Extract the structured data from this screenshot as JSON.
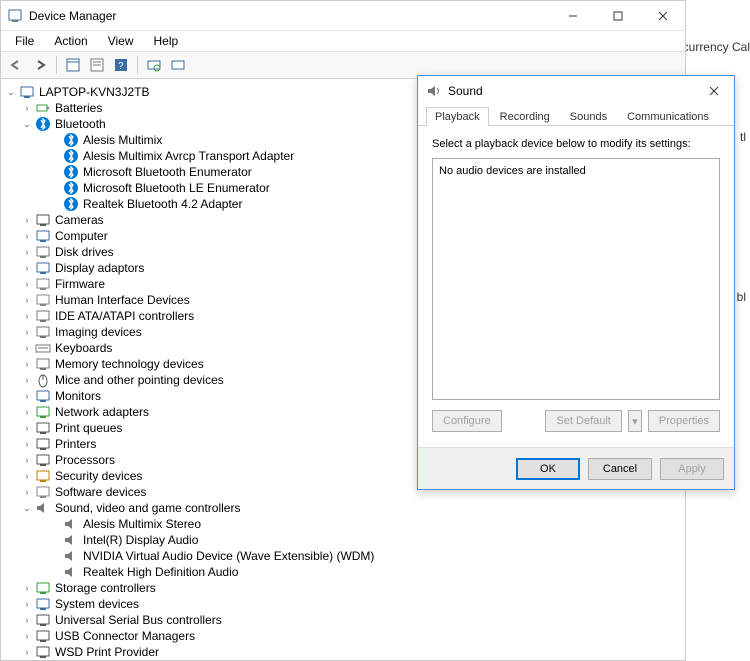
{
  "dm": {
    "title": "Device Manager",
    "menus": [
      "File",
      "Action",
      "View",
      "Help"
    ],
    "root": "LAPTOP-KVN3J2TB",
    "cats": [
      {
        "label": "Batteries",
        "exp": false,
        "icon": "battery"
      },
      {
        "label": "Bluetooth",
        "exp": true,
        "icon": "bt",
        "children": [
          "Alesis Multimix",
          "Alesis Multimix Avrcp Transport Adapter",
          "Microsoft Bluetooth Enumerator",
          "Microsoft Bluetooth LE Enumerator",
          "Realtek Bluetooth 4.2 Adapter"
        ]
      },
      {
        "label": "Cameras",
        "exp": false,
        "icon": "cam"
      },
      {
        "label": "Computer",
        "exp": false,
        "icon": "pc"
      },
      {
        "label": "Disk drives",
        "exp": false,
        "icon": "disk"
      },
      {
        "label": "Display adaptors",
        "exp": false,
        "icon": "disp"
      },
      {
        "label": "Firmware",
        "exp": false,
        "icon": "fw"
      },
      {
        "label": "Human Interface Devices",
        "exp": false,
        "icon": "hid"
      },
      {
        "label": "IDE ATA/ATAPI controllers",
        "exp": false,
        "icon": "ide"
      },
      {
        "label": "Imaging devices",
        "exp": false,
        "icon": "img"
      },
      {
        "label": "Keyboards",
        "exp": false,
        "icon": "kb"
      },
      {
        "label": "Memory technology devices",
        "exp": false,
        "icon": "mem"
      },
      {
        "label": "Mice and other pointing devices",
        "exp": false,
        "icon": "mouse"
      },
      {
        "label": "Monitors",
        "exp": false,
        "icon": "mon"
      },
      {
        "label": "Network adapters",
        "exp": false,
        "icon": "net"
      },
      {
        "label": "Print queues",
        "exp": false,
        "icon": "print"
      },
      {
        "label": "Printers",
        "exp": false,
        "icon": "print"
      },
      {
        "label": "Processors",
        "exp": false,
        "icon": "cpu"
      },
      {
        "label": "Security devices",
        "exp": false,
        "icon": "sec"
      },
      {
        "label": "Software devices",
        "exp": false,
        "icon": "sw"
      },
      {
        "label": "Sound, video and game controllers",
        "exp": true,
        "icon": "snd",
        "children": [
          "Alesis Multimix Stereo",
          "Intel(R) Display Audio",
          "NVIDIA Virtual Audio Device (Wave Extensible) (WDM)",
          "Realtek High Definition Audio"
        ]
      },
      {
        "label": "Storage controllers",
        "exp": false,
        "icon": "stor"
      },
      {
        "label": "System devices",
        "exp": false,
        "icon": "sys"
      },
      {
        "label": "Universal Serial Bus controllers",
        "exp": false,
        "icon": "usb"
      },
      {
        "label": "USB Connector Managers",
        "exp": false,
        "icon": "usb"
      },
      {
        "label": "WSD Print Provider",
        "exp": false,
        "icon": "print"
      }
    ]
  },
  "sound": {
    "title": "Sound",
    "tabs": [
      "Playback",
      "Recording",
      "Sounds",
      "Communications"
    ],
    "active_tab": 0,
    "instruction": "Select a playback device below to modify its settings:",
    "empty": "No audio devices are installed",
    "configure": "Configure",
    "set_default": "Set Default",
    "properties": "Properties",
    "ok": "OK",
    "cancel": "Cancel",
    "apply": "Apply"
  },
  "bg": {
    "frag1": "ocurrency Cal",
    "frag2": "tl",
    "frag3": "bl"
  },
  "icon_colors": {
    "bt": "#0078d7",
    "battery": "#3a9c3a",
    "cam": "#555",
    "pc": "#3a6ea5",
    "disk": "#777",
    "disp": "#3a6ea5",
    "fw": "#888",
    "hid": "#888",
    "ide": "#777",
    "img": "#777",
    "kb": "#777",
    "mem": "#777",
    "mouse": "#555",
    "mon": "#3a6ea5",
    "net": "#3a9c3a",
    "print": "#555",
    "cpu": "#555",
    "sec": "#c08000",
    "sw": "#888",
    "snd": "#777",
    "stor": "#3a9c3a",
    "sys": "#3a6ea5",
    "usb": "#555"
  }
}
